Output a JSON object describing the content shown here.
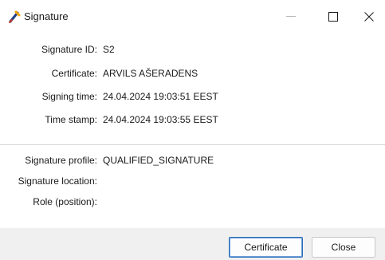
{
  "window": {
    "title": "Signature",
    "icons": {
      "app": "signature-app-icon",
      "minimize": "minimize-icon",
      "maximize": "maximize-icon",
      "close": "close-icon"
    }
  },
  "fields": {
    "signature_id": {
      "label": "Signature ID:",
      "value": "S2"
    },
    "certificate": {
      "label": "Certificate:",
      "value": "ARVILS AŠERADENS"
    },
    "signing_time": {
      "label": "Signing time:",
      "value": "24.04.2024 19:03:51 EEST"
    },
    "time_stamp": {
      "label": "Time stamp:",
      "value": "24.04.2024 19:03:55 EEST"
    },
    "signature_profile": {
      "label": "Signature profile:",
      "value": "QUALIFIED_SIGNATURE"
    },
    "signature_location": {
      "label": "Signature location:",
      "value": ""
    },
    "role": {
      "label": "Role (position):",
      "value": ""
    }
  },
  "buttons": {
    "certificate": "Certificate",
    "close": "Close"
  },
  "colors": {
    "footer_bg": "#f0f0f0",
    "primary_border": "#2b6cb8"
  }
}
